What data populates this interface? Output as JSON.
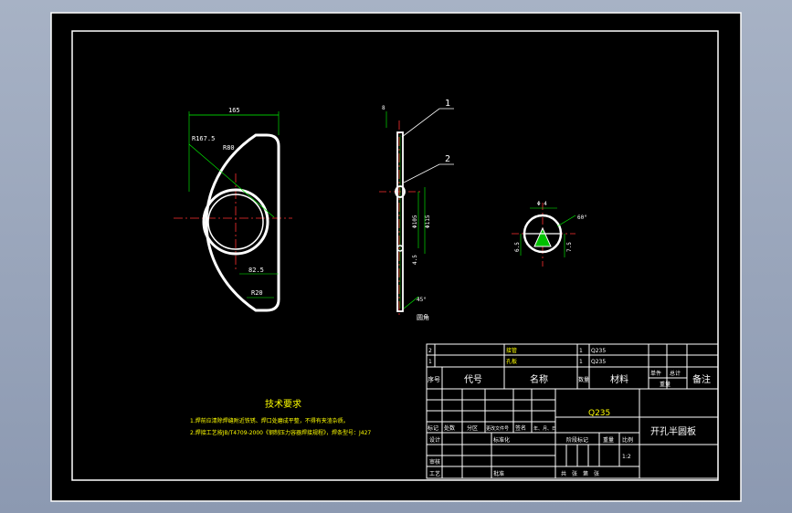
{
  "drawing": {
    "title": "开孔半圆板",
    "material": "Q235",
    "scale": "1:2"
  },
  "views": {
    "front": {
      "dim_width": "165",
      "dim_outer_radius": "R167.5",
      "dim_r_label": "R80",
      "dim_hole_diameter": "82.5",
      "dim_corner_radius": "R20"
    },
    "side": {
      "dim_top": "8",
      "dim_a": "Φ105",
      "dim_b": "Φ115",
      "dim_bottom": "4.5",
      "weld_angle": "45°",
      "weld_label": "圆角"
    },
    "detail": {
      "dim_top": "Φ 4",
      "angle": "60°",
      "dim_left": "6.5",
      "dim_right": "7.5"
    }
  },
  "balloons": [
    "1",
    "2"
  ],
  "notes": {
    "heading": "技术要求",
    "line1": "1.焊前应清除焊缝附近铁锈、焊口处磨成平整，不得有夹渣杂质。",
    "line2": "2.焊接工艺按JB/T4709-2000《钢制压力容器焊接规程》，焊条型号：J427"
  },
  "bom": {
    "rows": [
      {
        "no": "2",
        "code": "",
        "name": "接管",
        "qty": "1",
        "material": "Q235"
      },
      {
        "no": "1",
        "code": "",
        "name": "孔板",
        "qty": "1",
        "material": "Q235"
      }
    ],
    "header": {
      "no": "序号",
      "code": "代号",
      "name": "名称",
      "qty": "数量",
      "material": "材料",
      "unit_weight": "单件",
      "total_weight": "总计",
      "weight": "重量",
      "remark": "备注"
    }
  },
  "title_block": {
    "mark": "标记",
    "count": "处数",
    "zone": "分区",
    "change_doc": "更改文件号",
    "sign": "签名",
    "date": "年、月、日",
    "design": "设计",
    "standardize": "标准化",
    "review": "审核",
    "process": "工艺",
    "approve": "批准",
    "stage_mark": "阶段标记",
    "weight": "重量",
    "scale": "比例",
    "sheets": "共　张　第　张"
  },
  "colors": {
    "paper": "#000000",
    "line": "#ffffff",
    "center": "#ff3030",
    "dim": "#00ff00",
    "text": "#ffff00",
    "note": "#ffff00",
    "frame": "#ffffff",
    "hatch": "#00c000"
  }
}
